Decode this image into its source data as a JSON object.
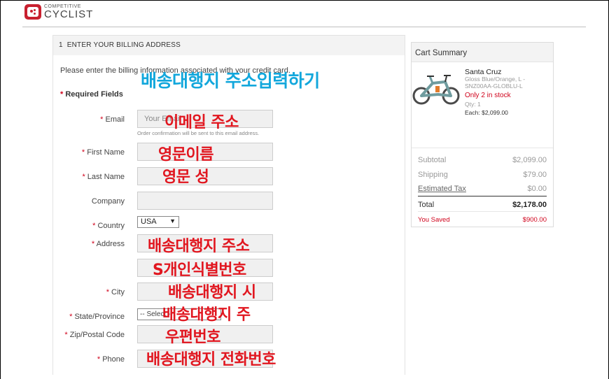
{
  "brand": {
    "line1": "COMPETITIVE",
    "line2": "CYCLIST"
  },
  "billing": {
    "step_number": "1",
    "step_title": "ENTER YOUR BILLING ADDRESS",
    "intro": "Please enter the billing information associated with your credit card.",
    "required_note": "Required Fields",
    "email": {
      "label": "Email",
      "placeholder": "Your Email",
      "hint": "Order confirmation will be sent to this email address."
    },
    "first_name": {
      "label": "First Name",
      "value": ""
    },
    "last_name": {
      "label": "Last Name",
      "value": ""
    },
    "company": {
      "label": "Company",
      "value": ""
    },
    "country": {
      "label": "Country",
      "value": "USA"
    },
    "address": {
      "label": "Address",
      "value": ""
    },
    "address2": {
      "value": ""
    },
    "city": {
      "label": "City",
      "value": ""
    },
    "state": {
      "label": "State/Province",
      "value": "-- Select --"
    },
    "zip": {
      "label": "Zip/Postal Code",
      "value": ""
    },
    "phone": {
      "label": "Phone",
      "value": ""
    }
  },
  "annotations": {
    "title": "배송대행지 주소입력하기",
    "email": "이메일 주소",
    "first_name": "영문이름",
    "last_name": "영문 성",
    "address": "배송대행지 주소",
    "address2": "S개인식별번호",
    "city": "배송대행지 시",
    "state": "배송대행지 주",
    "zip": "우편번호",
    "phone": "배송대행지 전화번호"
  },
  "cart": {
    "title": "Cart Summary",
    "product": {
      "name": "Santa Cruz",
      "variant_line1": "Gloss Blue/Orange, L -",
      "variant_line2": "SNZ00AA-GLOBLU-L",
      "stock": "Only  2 in stock",
      "qty": "Qty: 1",
      "each": "Each: $2,099.00"
    },
    "subtotal": {
      "label": "Subtotal",
      "value": "$2,099.00"
    },
    "shipping": {
      "label": "Shipping",
      "value": "$79.00"
    },
    "tax": {
      "label": "Estimated Tax",
      "value": "$0.00"
    },
    "total": {
      "label": "Total",
      "value": "$2,178.00"
    },
    "saved": {
      "label": "You Saved",
      "value": "$900.00"
    }
  },
  "colors": {
    "accent_red": "#d0021b",
    "annotation_red": "#e1161f",
    "annotation_cyan": "#12a7dc"
  }
}
